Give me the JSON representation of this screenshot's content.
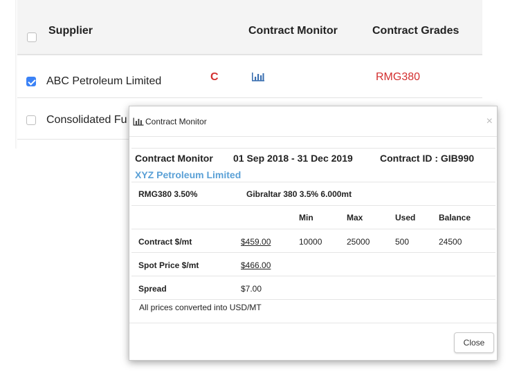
{
  "table": {
    "headers": {
      "supplier": "Supplier",
      "contract_monitor": "Contract Monitor",
      "contract_grades": "Contract Grades"
    },
    "rows": [
      {
        "checked": true,
        "supplier": "ABC Petroleum Limited",
        "marker": "C",
        "grade": "RMG380"
      },
      {
        "checked": false,
        "supplier": "Consolidated Fu"
      }
    ]
  },
  "modal": {
    "title": "Contract Monitor",
    "close_x": "×",
    "info": {
      "label": "Contract Monitor",
      "period": "01 Sep 2018 - 31 Dec 2019",
      "contract_id": "Contract ID : GIB990",
      "supplier": "XYZ Petroleum Limited"
    },
    "grade": {
      "code": "RMG380 3.50%",
      "description": "Gibraltar 380 3.5% 6.000mt"
    },
    "columns": [
      "Min",
      "Max",
      "Used",
      "Balance"
    ],
    "rows": [
      {
        "label": "Contract $/mt",
        "price": "$459.00",
        "min": "10000",
        "max": "25000",
        "used": "500",
        "balance": "24500"
      },
      {
        "label": "Spot Price $/mt",
        "price": "$466.00"
      },
      {
        "label": "Spread",
        "price": "$7.00"
      }
    ],
    "note": "All prices converted into USD/MT",
    "close_label": "Close"
  },
  "colors": {
    "accent_blue": "#5aa0d6",
    "checkbox_blue": "#3b82f6",
    "alert_red": "#d32f2f",
    "icon_blue": "#3a6fb0"
  }
}
